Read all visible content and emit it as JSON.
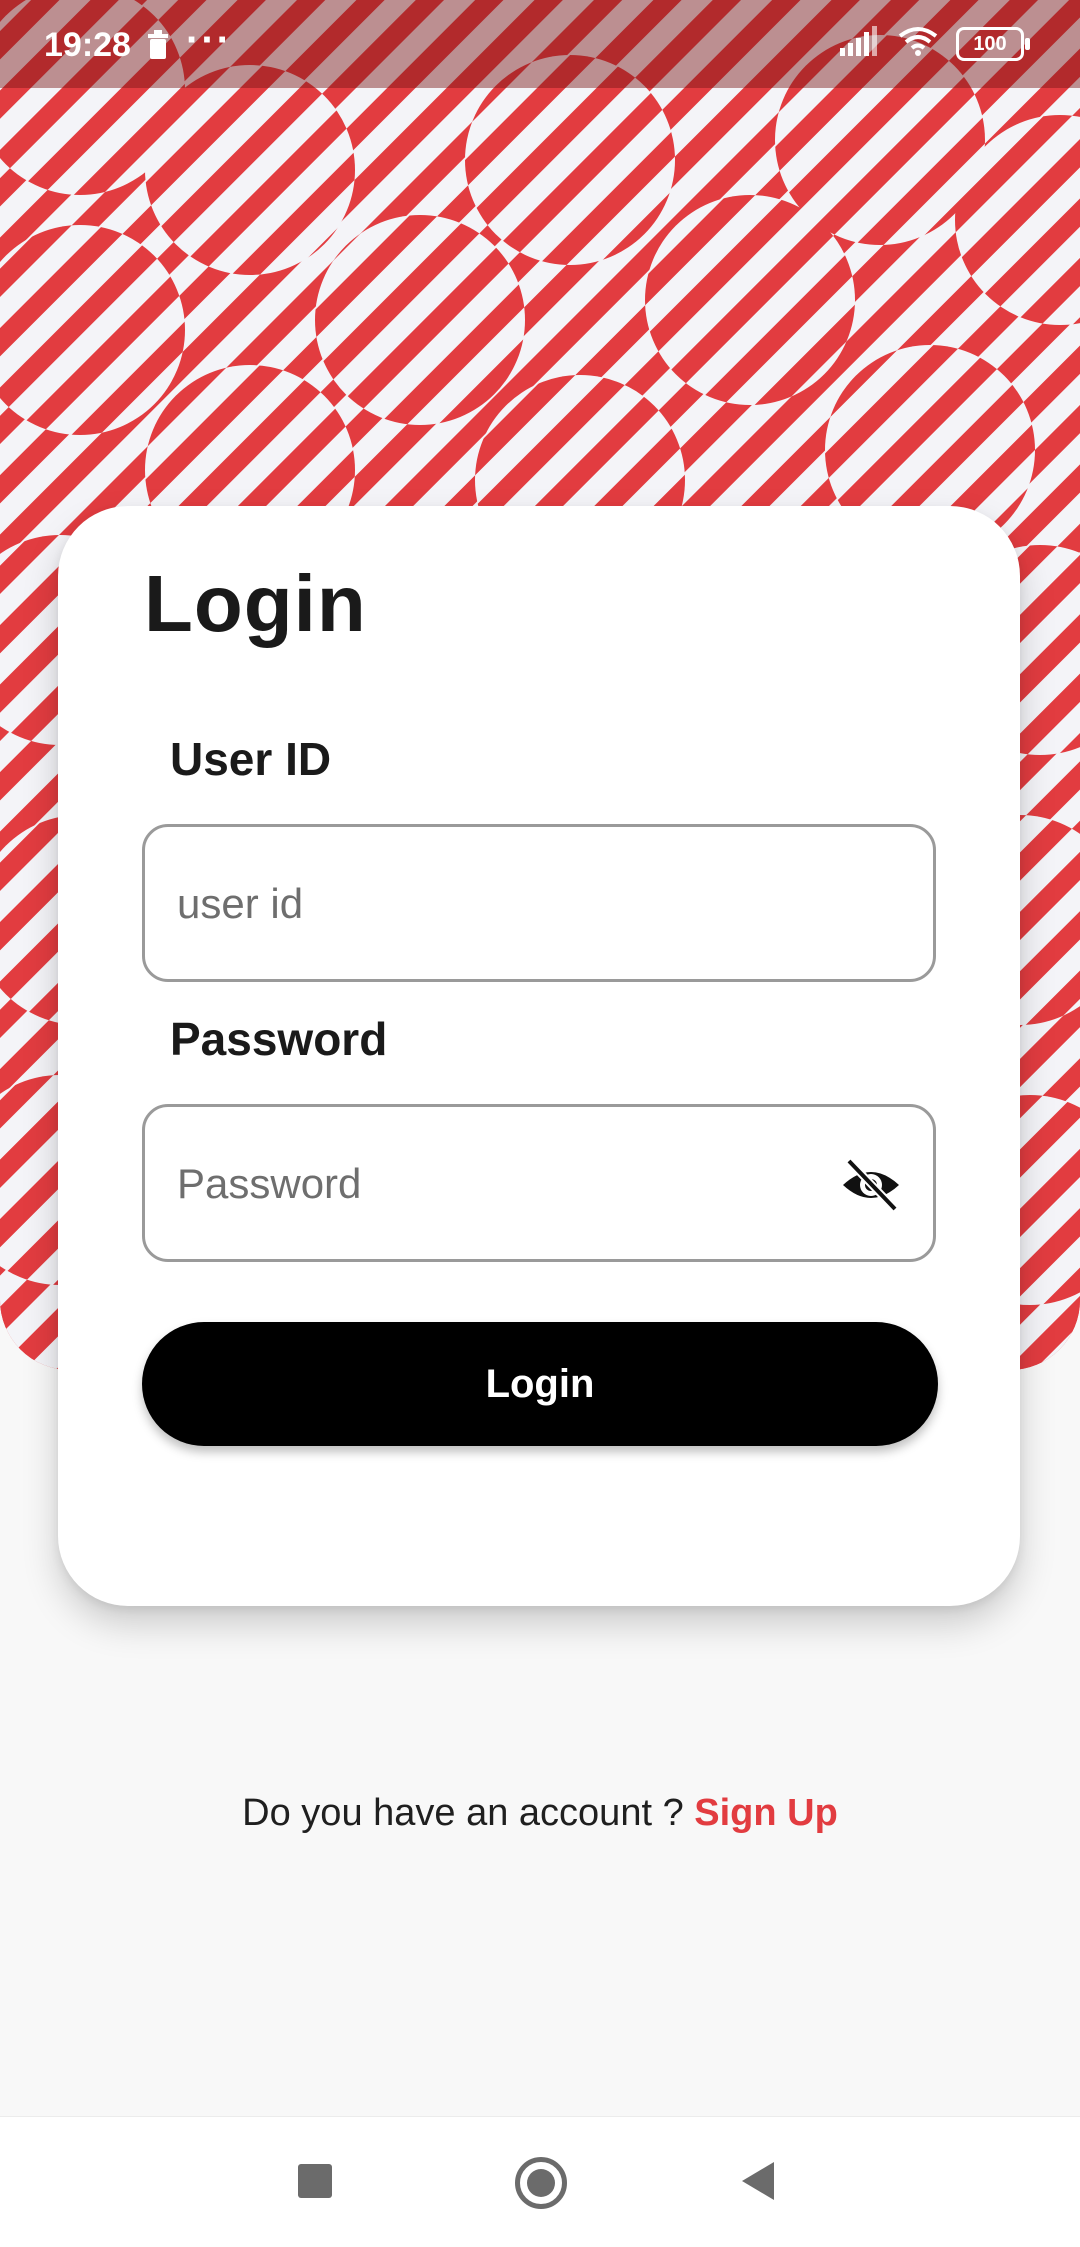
{
  "status_bar": {
    "time": "19:28",
    "overflow": "···",
    "battery": "100"
  },
  "card": {
    "title": "Login",
    "user_id_label": "User ID",
    "user_id_placeholder": "user id",
    "user_id_value": "",
    "password_label": "Password",
    "password_placeholder": "Password",
    "password_value": "",
    "login_button": "Login"
  },
  "footer": {
    "question": "Do you have an account ?",
    "signup_link": "Sign Up"
  },
  "colors": {
    "accent": "#e23c40",
    "button": "#000000",
    "background": "#f8f8f8"
  },
  "icons": {
    "password_toggle": "eye-off-icon",
    "nav_recent": "square-icon",
    "nav_home": "circle-icon",
    "nav_back": "triangle-back-icon"
  }
}
